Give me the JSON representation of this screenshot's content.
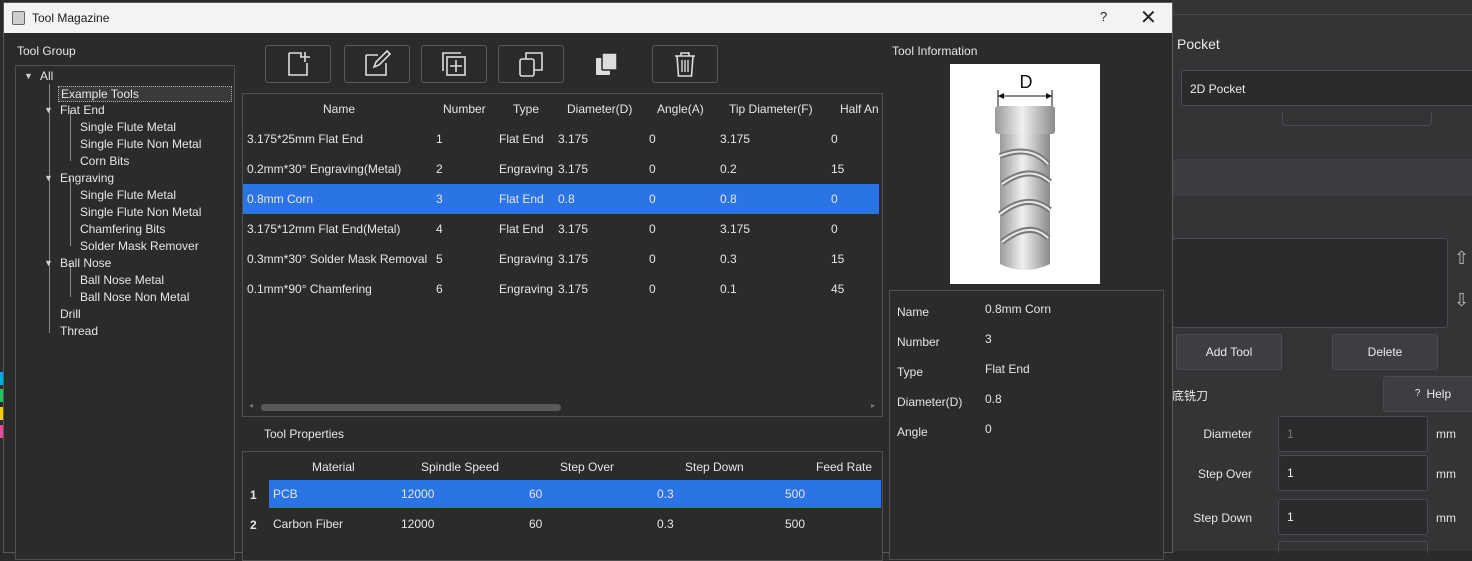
{
  "window": {
    "title": "Tool Magazine",
    "help": "?",
    "close": "✕"
  },
  "tool_group": {
    "label": "Tool Group",
    "tree": [
      {
        "label": "All",
        "level": 0,
        "expanded": true
      },
      {
        "label": "Example Tools",
        "level": 1,
        "selected": true
      },
      {
        "label": "Flat End",
        "level": 1,
        "expanded": true
      },
      {
        "label": "Single Flute Metal",
        "level": 2
      },
      {
        "label": "Single Flute Non Metal",
        "level": 2
      },
      {
        "label": "Corn Bits",
        "level": 2
      },
      {
        "label": "Engraving",
        "level": 1,
        "expanded": true
      },
      {
        "label": "Single Flute Metal",
        "level": 2
      },
      {
        "label": "Single Flute Non Metal",
        "level": 2
      },
      {
        "label": "Chamfering Bits",
        "level": 2
      },
      {
        "label": "Solder Mask Remover",
        "level": 2
      },
      {
        "label": "Ball Nose",
        "level": 1,
        "expanded": true
      },
      {
        "label": "Ball Nose Metal",
        "level": 2
      },
      {
        "label": "Ball Nose Non Metal",
        "level": 2
      },
      {
        "label": "Drill",
        "level": 1
      },
      {
        "label": "Thread",
        "level": 1
      }
    ]
  },
  "toolbar": {
    "buttons": [
      {
        "name": "new-tool",
        "icon": "new-file-icon"
      },
      {
        "name": "edit-tool",
        "icon": "edit-icon"
      },
      {
        "name": "duplicate-tool",
        "icon": "duplicate-icon"
      },
      {
        "name": "copy-tool",
        "icon": "copy-icon"
      },
      {
        "name": "paste-tool",
        "icon": "paste-icon"
      },
      {
        "name": "delete-tool",
        "icon": "trash-icon"
      }
    ]
  },
  "tools_table": {
    "columns": [
      "Name",
      "Number",
      "Type",
      "Diameter(D)",
      "Angle(A)",
      "Tip Diameter(F)",
      "Half An"
    ],
    "rows": [
      [
        "3.175*25mm Flat End",
        "1",
        "Flat End",
        "3.175",
        "0",
        "3.175",
        "0"
      ],
      [
        "0.2mm*30° Engraving(Metal)",
        "2",
        "Engraving",
        "3.175",
        "0",
        "0.2",
        "15"
      ],
      [
        "0.8mm Corn",
        "3",
        "Flat End",
        "0.8",
        "0",
        "0.8",
        "0"
      ],
      [
        "3.175*12mm Flat End(Metal)",
        "4",
        "Flat End",
        "3.175",
        "0",
        "3.175",
        "0"
      ],
      [
        "0.3mm*30° Solder Mask Removal",
        "5",
        "Engraving",
        "3.175",
        "0",
        "0.3",
        "15"
      ],
      [
        "0.1mm*90° Chamfering",
        "6",
        "Engraving",
        "3.175",
        "0",
        "0.1",
        "45"
      ]
    ],
    "selected_row": 2
  },
  "tool_properties": {
    "label": "Tool Properties",
    "columns": [
      "Material",
      "Spindle Speed",
      "Step Over",
      "Step Down",
      "Feed Rate"
    ],
    "rows": [
      {
        "index": "1",
        "cells": [
          "PCB",
          "12000",
          "60",
          "0.3",
          "500"
        ]
      },
      {
        "index": "2",
        "cells": [
          "Carbon Fiber",
          "12000",
          "60",
          "0.3",
          "500"
        ]
      }
    ],
    "selected_row": 0
  },
  "tool_information": {
    "label": "Tool Information",
    "diagram_label": "D",
    "fields": [
      {
        "key": "Name",
        "value": "0.8mm Corn"
      },
      {
        "key": "Number",
        "value": "3"
      },
      {
        "key": "Type",
        "value": "Flat End"
      },
      {
        "key": "Diameter(D)",
        "value": "0.8"
      },
      {
        "key": "Angle",
        "value": "0"
      }
    ]
  },
  "background_app": {
    "title": "Pocket",
    "mode_value": "2D Pocket",
    "add_tool": "Add Tool",
    "delete": "Delete",
    "tool_label": "底铣刀",
    "help": "Help",
    "help_icon": "?",
    "fields": [
      {
        "label": "Diameter",
        "value": "",
        "placeholder": "1",
        "unit": "mm"
      },
      {
        "label": "Step Over",
        "value": "1",
        "unit": "mm"
      },
      {
        "label": "Step Down",
        "value": "1",
        "unit": "mm"
      }
    ]
  },
  "colors": {
    "selection": "#2b74e6",
    "background": "#2b2b2b",
    "strips": [
      "#00a8e8",
      "#22c55e",
      "#facc15",
      "#ec4899"
    ]
  }
}
